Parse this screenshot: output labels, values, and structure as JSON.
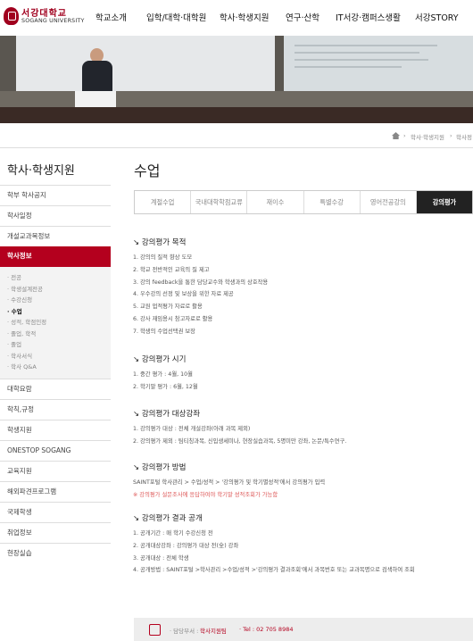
{
  "header": {
    "logo_kr": "서강대학교",
    "logo_en": "SOGANG UNIVERSITY",
    "nav": [
      "학교소개",
      "입학/대학·대학원",
      "학사·학생지원",
      "연구·산학",
      "IT서강·캠퍼스생활",
      "서강STORY"
    ]
  },
  "breadcrumb": [
    "학사·학생지원",
    "학사정"
  ],
  "sidebar": {
    "title": "학사·학생지원",
    "items_top": [
      "학부 학사공지",
      "학사일정",
      "개설교과목정보"
    ],
    "active": "학사정보",
    "sub": [
      "전공",
      "학생설계전공",
      "수강신청",
      "수업",
      "성적, 학점인정",
      "졸업, 학적",
      "졸업",
      "학사서식",
      "학사 Q&A"
    ],
    "sub_active_index": 3,
    "items_bottom": [
      "대학요람",
      "학칙,규정",
      "학생지원",
      "ONESTOP SOGANG",
      "교육지원",
      "해외파견프로그램",
      "국제학생",
      "취업정보",
      "현장실습"
    ]
  },
  "main": {
    "title": "수업",
    "tabs": [
      "계절수업",
      "국내대학학점교류",
      "재이수",
      "특별수강",
      "영어전공강의",
      "강의평가"
    ],
    "active_tab": 5,
    "sections": [
      {
        "heading": "강의평가 목적",
        "lines": [
          "1. 강의의 질적 향상 도모",
          "2. 학교 전반적인 교육의 질 제고",
          "3. 강의 feedback을 통한 담당교수와 학생과의 상호작용",
          "4. 우수강의 선정 및 보상을 위한 자료 제공",
          "5. 교원 업적평가 자료로 활용",
          "6. 강사 재임용시 참고자료로 활용",
          "7. 학생의 수업선택권 보장"
        ]
      },
      {
        "heading": "강의평가 시기",
        "lines": [
          "1. 중간 평가 : 4월, 10월",
          "2. 학기말 평가 : 6월, 12월"
        ]
      },
      {
        "heading": "강의평가 대상강좌",
        "lines": [
          "1. 강의평가 대상 : 전체 개설강좌(아래 과목 제외)",
          "2. 강의평가 제외 : 팀티칭과목, 신입생세미나, 현장실습과목, 5명미만 강좌, 논문/특수연구."
        ]
      },
      {
        "heading": "강의평가 방법",
        "lines": [
          "SAINT포털 학사관리 > 수업/성적 > '강의평가 및 학기별성적'에서 강의평가 입력"
        ],
        "note": "※ 강의평가 설문조사에 응답하여야 학기말 성적조회가 가능함"
      },
      {
        "heading": "강의평가 결과 공개",
        "lines": [
          "1. 공개기간 : 매 학기 수강신청 전",
          "2. 공개대상강좌 : 강의평가 대상 전(全) 강좌",
          "3. 공개대상 : 전체 학생",
          "4. 공개방법 : SAINT포털 >학사관리 >수업/성적 >'강의평가 결과조회'에서 과목번호 또는 교과목명으로 검색하여 조회"
        ]
      }
    ]
  },
  "footer": {
    "label": "· 담당부서 :",
    "dept": "학사지원팀",
    "tel": "· Tel : 02 705 8984"
  },
  "colors": {
    "accent": "#b4001e",
    "tab_active": "#222222"
  }
}
